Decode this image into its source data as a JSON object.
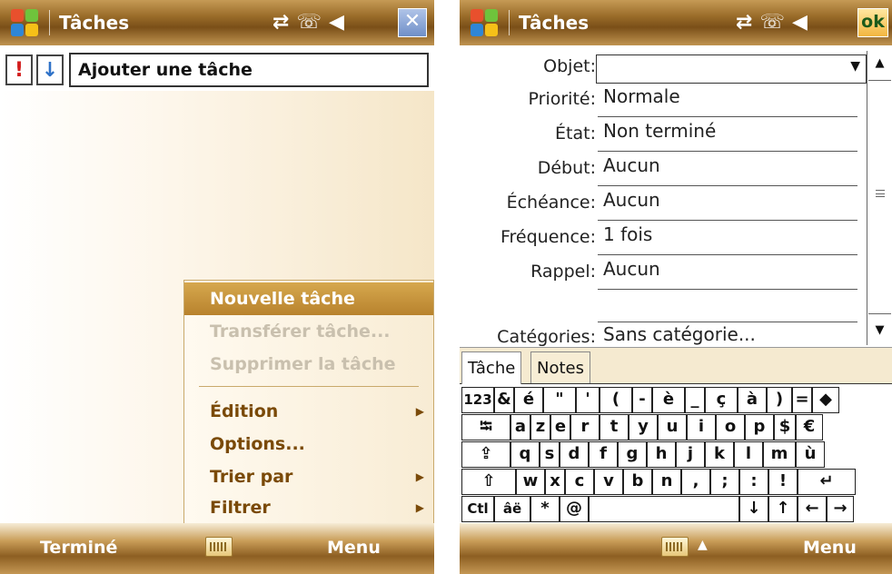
{
  "left": {
    "title": "Tâches",
    "quick_entry_placeholder": "Ajouter une tâche",
    "priority_high_icon": "!",
    "priority_low_icon": "↓",
    "menu": {
      "new_task": "Nouvelle tâche",
      "transfer_task": "Transférer tâche...",
      "delete_task": "Supprimer la tâche",
      "edit": "Édition",
      "options": "Options...",
      "sort_by": "Trier par",
      "filter": "Filtrer"
    },
    "softkeys": {
      "left": "Terminé",
      "right": "Menu"
    }
  },
  "right": {
    "title": "Tâches",
    "ok_label": "ok",
    "form": {
      "objet_label": "Objet:",
      "objet_value": "",
      "priorite_label": "Priorité:",
      "priorite_value": "Normale",
      "etat_label": "État:",
      "etat_value": "Non terminé",
      "debut_label": "Début:",
      "debut_value": "Aucun",
      "echeance_label": "Échéance:",
      "echeance_value": "Aucun",
      "frequence_label": "Fréquence:",
      "frequence_value": "1 fois",
      "rappel_label": "Rappel:",
      "rappel_value": "Aucun",
      "categories_label": "Catégories:",
      "categories_value": "Sans catégorie..."
    },
    "tabs": {
      "task": "Tâche",
      "notes": "Notes"
    },
    "softkeys": {
      "right": "Menu"
    },
    "keyboard": {
      "row1": [
        "123",
        "&",
        "é",
        "\"",
        "'",
        "(",
        "-",
        "è",
        "_",
        "ç",
        "à",
        ")",
        "=",
        "◆"
      ],
      "row2": [
        "⭾",
        "a",
        "z",
        "e",
        "r",
        "t",
        "y",
        "u",
        "i",
        "o",
        "p",
        "$",
        "€"
      ],
      "row3": [
        "⇪",
        "q",
        "s",
        "d",
        "f",
        "g",
        "h",
        "j",
        "k",
        "l",
        "m",
        "ù"
      ],
      "row4": [
        "⇧",
        "w",
        "x",
        "c",
        "v",
        "b",
        "n",
        ",",
        ";",
        ":",
        "!",
        "↵"
      ],
      "row5": [
        "Ctl",
        "âë",
        "*",
        "@",
        "",
        "↓",
        "↑",
        "←",
        "→"
      ]
    }
  },
  "colors": {
    "titlebar": "#8d5f22",
    "menu_text": "#7a4a08",
    "menu_selected": "#c8953c",
    "priority_high": "#d21d1d",
    "priority_low": "#2f72c8"
  },
  "icons": {
    "status": [
      "connectivity-icon",
      "phone-signal-icon",
      "speaker-icon"
    ],
    "start": "windows-start-icon",
    "close": "close-icon",
    "keyboard": "keyboard-icon"
  }
}
